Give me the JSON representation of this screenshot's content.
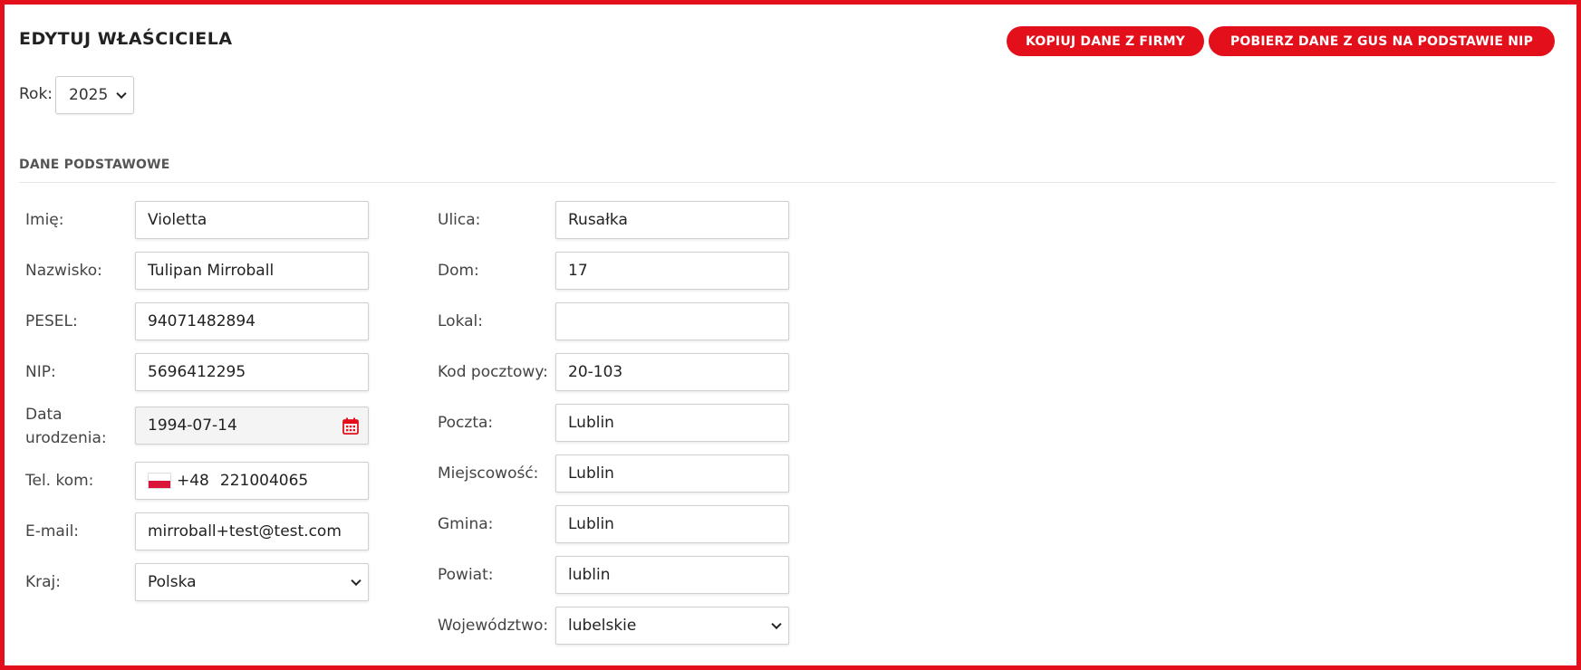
{
  "header": {
    "title": "EDYTUJ WŁAŚCICIELA",
    "copy_button": "KOPIUJ DANE Z FIRMY",
    "gus_button": "POBIERZ DANE Z GUS NA PODSTAWIE NIP"
  },
  "year": {
    "label": "Rok:",
    "value": "2025"
  },
  "section": {
    "title": "DANE PODSTAWOWE"
  },
  "left_fields": {
    "imie": {
      "label": "Imię:",
      "value": "Violetta"
    },
    "nazwisko": {
      "label": "Nazwisko:",
      "value": "Tulipan Mirroball"
    },
    "pesel": {
      "label": "PESEL:",
      "value": "94071482894"
    },
    "nip": {
      "label": "NIP:",
      "value": "5696412295"
    },
    "data_urodzenia": {
      "label_line1": "Data",
      "label_line2": "urodzenia:",
      "value": "1994-07-14"
    },
    "tel_kom": {
      "label": "Tel. kom:",
      "country_code": "+48",
      "value": "221004065",
      "flag": "poland-flag"
    },
    "email": {
      "label": "E-mail:",
      "value": "mirroball+test@test.com"
    },
    "kraj": {
      "label": "Kraj:",
      "value": "Polska"
    }
  },
  "right_fields": {
    "ulica": {
      "label": "Ulica:",
      "value": "Rusałka"
    },
    "dom": {
      "label": "Dom:",
      "value": "17"
    },
    "lokal": {
      "label": "Lokal:",
      "value": ""
    },
    "kod_pocztowy": {
      "label": "Kod pocztowy:",
      "value": "20-103"
    },
    "poczta": {
      "label": "Poczta:",
      "value": "Lublin"
    },
    "miejscowosc": {
      "label": "Miejscowość:",
      "value": "Lublin"
    },
    "gmina": {
      "label": "Gmina:",
      "value": "Lublin"
    },
    "powiat": {
      "label": "Powiat:",
      "value": "lublin"
    },
    "wojewodztwo": {
      "label": "Województwo:",
      "value": "lubelskie"
    }
  },
  "icons": {
    "calendar": "calendar-icon",
    "dropdown": "chevron-down-icon"
  },
  "colors": {
    "accent": "#e3101b",
    "border": "#e3101b"
  }
}
